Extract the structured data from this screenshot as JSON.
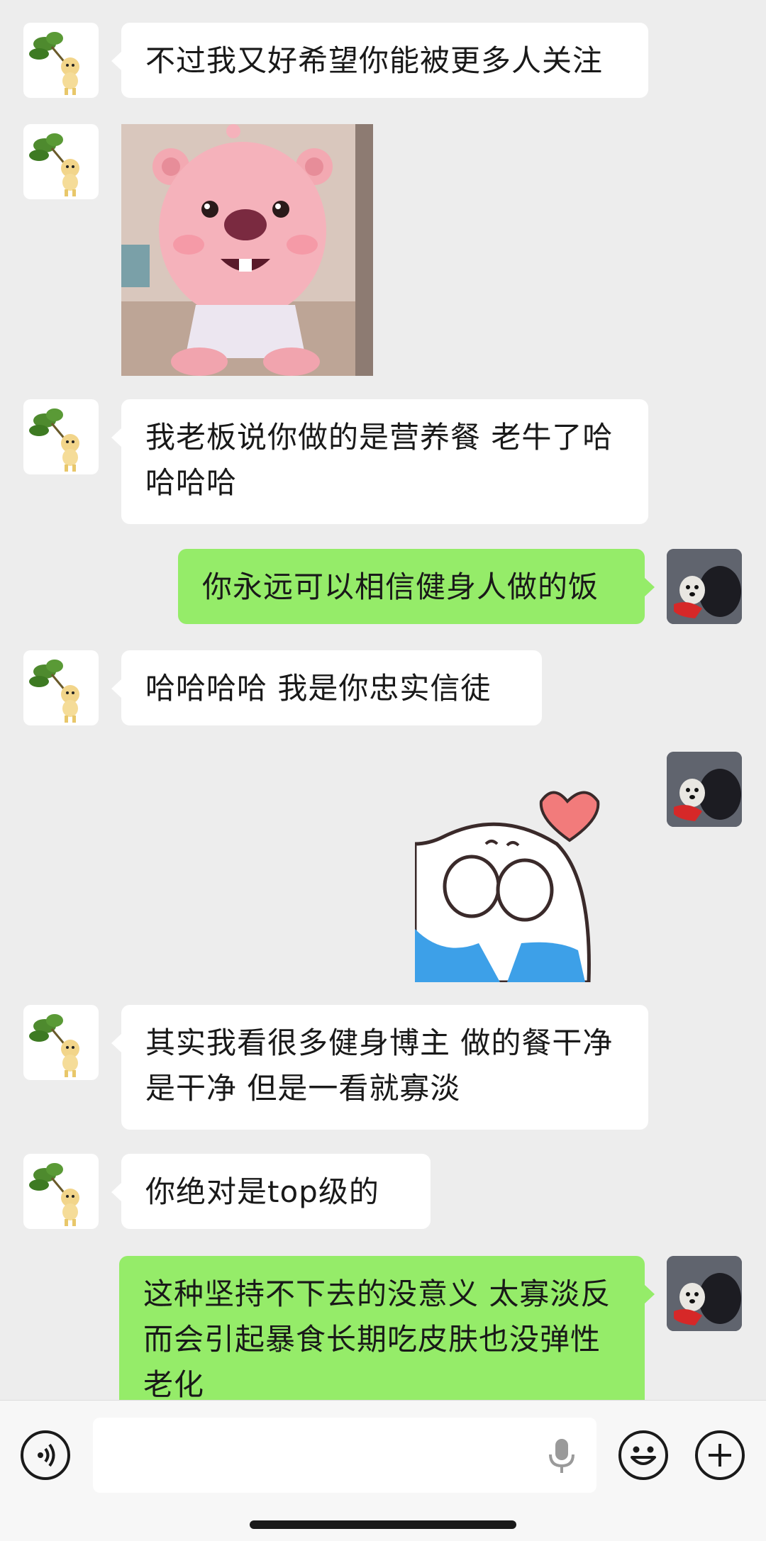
{
  "messages": [
    {
      "side": "in",
      "text": "不过我又好希望你能被更多人关注"
    },
    {
      "side": "in",
      "type": "sticker",
      "sticker": "pink-beaver-sticker"
    },
    {
      "side": "in",
      "text": "我老板说你做的是营养餐 老牛了哈哈哈哈"
    },
    {
      "side": "out",
      "text": "你永远可以相信健身人做的饭"
    },
    {
      "side": "in",
      "text": "哈哈哈哈 我是你忠实信徒"
    },
    {
      "side": "out",
      "type": "sticker",
      "sticker": "shy-heart-sticker"
    },
    {
      "side": "in",
      "text": "其实我看很多健身博主 做的餐干净是干净 但是一看就寡淡"
    },
    {
      "side": "in",
      "text": "你绝对是top级的"
    },
    {
      "side": "out",
      "text": "这种坚持不下去的没意义 太寡淡反而会引起暴食长期吃皮肤也没弹性老化"
    }
  ],
  "input_bar": {
    "voice_icon": "voice-icon",
    "mic_icon": "microphone-icon",
    "emoji_icon": "emoji-icon",
    "plus_icon": "plus-icon",
    "input_value": ""
  },
  "colors": {
    "background": "#ededed",
    "incoming_bubble": "#ffffff",
    "outgoing_bubble": "#95ec69"
  }
}
